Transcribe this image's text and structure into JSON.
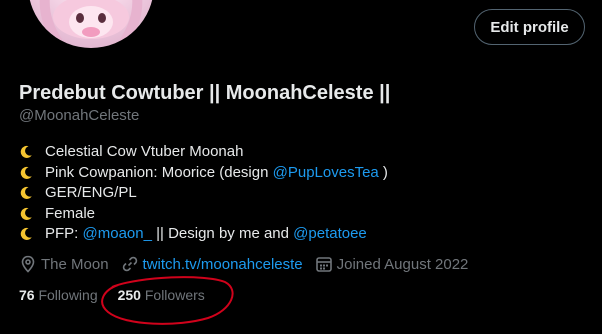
{
  "profile": {
    "display_name": "Predebut Cowtuber || MoonahCeleste ||",
    "handle": "@MoonahCeleste",
    "edit_button_label": "Edit profile"
  },
  "bio": {
    "line1": {
      "text": "Celestial Cow Vtuber Moonah"
    },
    "line2": {
      "text_before": "Pink Cowpanion: Moorice (design ",
      "mention": "@PupLovesTea",
      "text_after": " )"
    },
    "line3": {
      "text": "GER/ENG/PL"
    },
    "line4": {
      "text": "Female"
    },
    "line5": {
      "text_before": "PFP: ",
      "mention1": "@moaon_",
      "text_middle": " || Design by me and ",
      "mention2": "@petatoee"
    }
  },
  "meta": {
    "location": "The Moon",
    "website": "twitch.tv/moonahceleste",
    "joined": "Joined August 2022"
  },
  "stats": {
    "following_count": "76",
    "following_label": "Following",
    "followers_count": "250",
    "followers_label": "Followers"
  },
  "colors": {
    "background": "#000000",
    "text": "#e7e9ea",
    "secondary_text": "#71767b",
    "link": "#1d9bf0",
    "annotation": "#d0021b",
    "moon": "#f4c430"
  },
  "icons": [
    "crescent-moon-icon",
    "location-pin-icon",
    "link-icon",
    "calendar-icon"
  ]
}
